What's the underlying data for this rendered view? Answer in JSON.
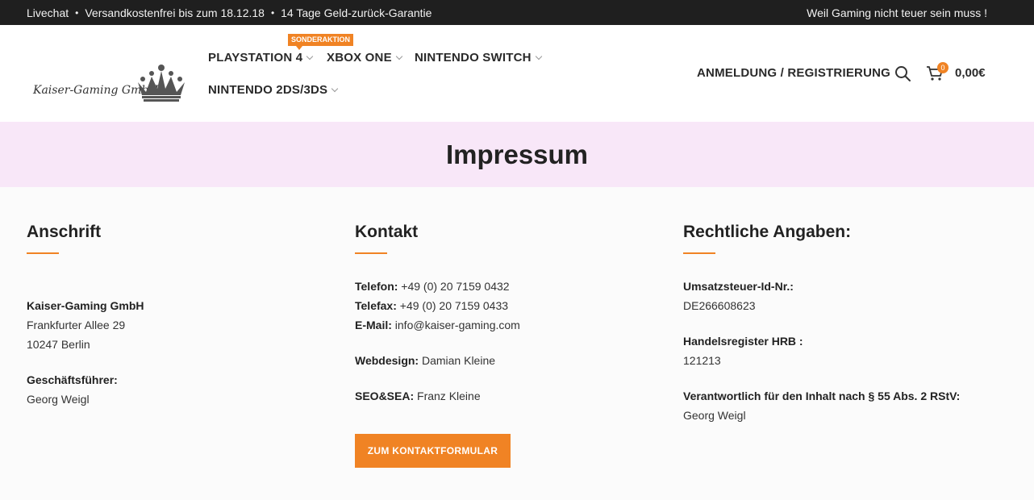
{
  "topbar": {
    "items": [
      "Livechat",
      "Versandkostenfrei bis zum 18.12.18",
      "14 Tage Geld-zurück-Garantie"
    ],
    "tagline": "Weil Gaming nicht teuer sein muss !"
  },
  "header": {
    "logo_text": "Kaiser-Gaming GmbH",
    "nav": [
      {
        "label": "PLAYSTATION 4",
        "badge": "SONDERAKTION"
      },
      {
        "label": "XBOX ONE"
      },
      {
        "label": "NINTENDO SWITCH"
      },
      {
        "label": "NINTENDO 2DS/3DS"
      }
    ],
    "login": "ANMELDUNG / REGISTRIERUNG",
    "cart_count": "0",
    "cart_total": "0,00€",
    "accent_color": "#f08324"
  },
  "page": {
    "title": "Impressum",
    "title_band_color": "#f8e7f8"
  },
  "anschrift": {
    "heading": "Anschrift",
    "company": "Kaiser-Gaming GmbH",
    "street": "Frankfurter Allee 29",
    "city": "10247 Berlin",
    "manager_label": "Geschäftsführer:",
    "manager": "Georg Weigl"
  },
  "kontakt": {
    "heading": "Kontakt",
    "phone_label": "Telefon:",
    "phone": "+49 (0) 20 7159 0432",
    "fax_label": "Telefax:",
    "fax": "+49 (0) 20 7159 0433",
    "email_label": "E-Mail:",
    "email": "info@kaiser-gaming.com",
    "webdesign_label": "Webdesign:",
    "webdesign": "Damian Kleine",
    "seo_label": "SEO&SEA:",
    "seo": "Franz Kleine",
    "button": "ZUM KONTAKTFORMULAR"
  },
  "rechtlich": {
    "heading": "Rechtliche Angaben:",
    "vat_label": "Umsatzsteuer-Id-Nr.:",
    "vat": "DE266608623",
    "hrb_label": "Handelsregister HRB :",
    "hrb": "121213",
    "resp_label": "Verantwortlich für den Inhalt nach § 55 Abs. 2 RStV:",
    "resp": "Georg Weigl"
  }
}
